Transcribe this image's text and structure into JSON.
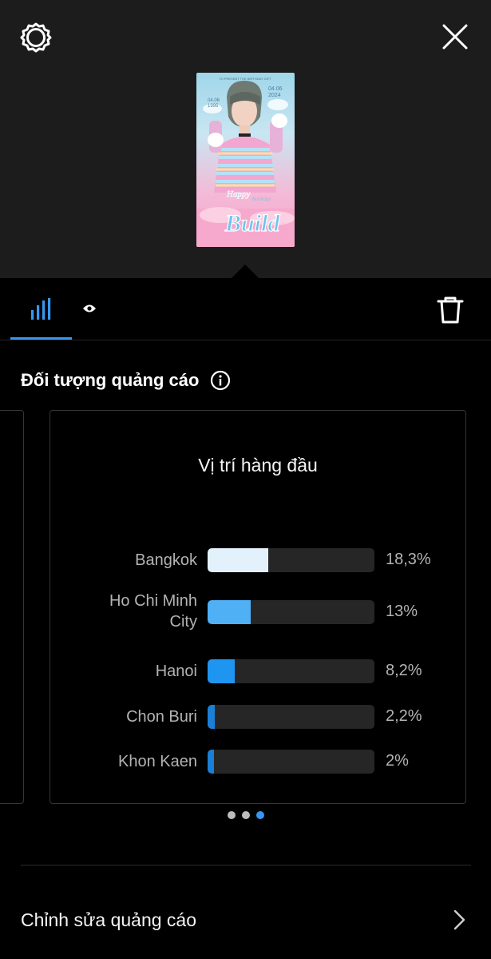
{
  "header": {
    "settings_icon": "settings-icon",
    "close_icon": "close-icon",
    "thumbnail": {
      "top_text": "TO PRESENT THE BIRTHDAY GIFT",
      "date_left": "04.06\n1995",
      "date_right": "04.06\n2024",
      "happy": "Happy",
      "birthday": "birthday",
      "name": "Build"
    }
  },
  "tabs": [
    {
      "name": "statistics",
      "icon": "bar-chart-icon",
      "active": true
    },
    {
      "name": "preview",
      "icon": "eye-icon",
      "active": false
    }
  ],
  "toolbar": {
    "delete_icon": "trash-icon"
  },
  "audience": {
    "title": "Đối tượng quảng cáo",
    "info_icon": "info-icon"
  },
  "card": {
    "title": "Vị trí hàng đầu"
  },
  "chart_data": {
    "type": "bar",
    "orientation": "horizontal",
    "title": "Vị trí hàng đầu",
    "categories": [
      "Bangkok",
      "Ho Chi Minh City",
      "Hanoi",
      "Chon Buri",
      "Khon Kaen"
    ],
    "values": [
      18.3,
      13,
      8.2,
      2.2,
      2
    ],
    "value_labels": [
      "18,3%",
      "13%",
      "8,2%",
      "2,2%",
      "2%"
    ],
    "colors": [
      "#e3f1fd",
      "#4fb0f5",
      "#1f95f2",
      "#1a7fd6",
      "#1a7fd6"
    ],
    "xlim": [
      0,
      100
    ],
    "grid": false
  },
  "pager": {
    "count": 3,
    "active": 2
  },
  "edit": {
    "label": "Chỉnh sửa quảng cáo",
    "chevron_icon": "chevron-right-icon"
  }
}
